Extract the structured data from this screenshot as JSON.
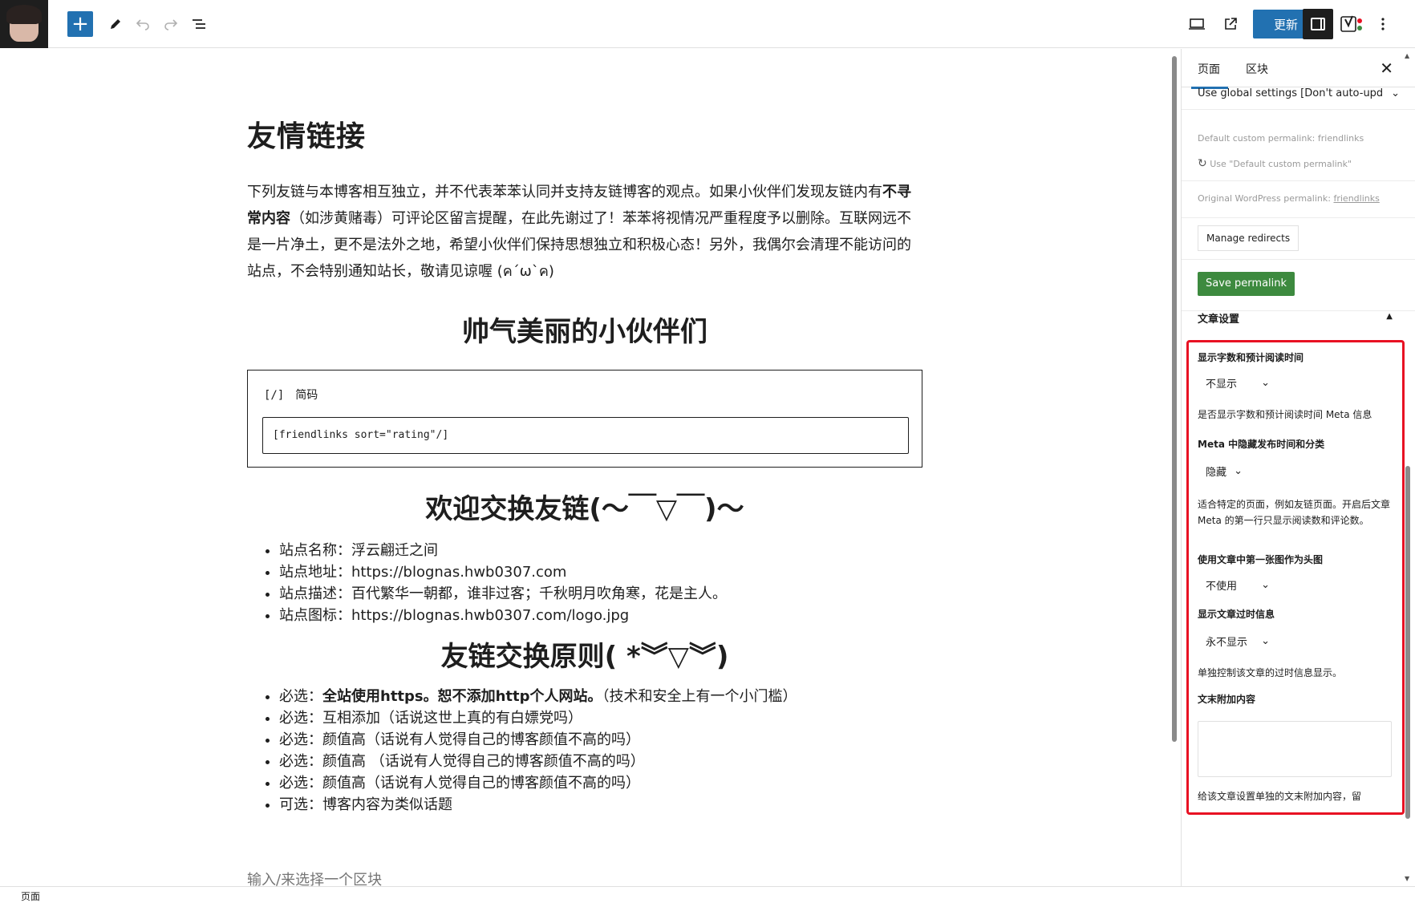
{
  "toolbar": {
    "update_label": "更新",
    "icons": [
      "add-icon",
      "pencil-icon",
      "undo-icon",
      "redo-icon",
      "list-view-icon",
      "desktop-preview-icon",
      "external-link-icon",
      "panel-icon",
      "yoast-icon",
      "more-icon"
    ]
  },
  "post": {
    "title": "友情链接",
    "intro_part1": "下列友链与本博客相互独立，并不代表苯苯认同并支持友链博客的观点。如果小伙伴们发现友链内有",
    "intro_bold": "不寻常内容",
    "intro_part2": "（如涉黄赌毒）可评论区留言提醒，在此先谢过了！苯苯将视情况严重程度予以删除。互联网远不是一片净土，更不是法外之地，希望小伙伴们保持思想独立和积极心态！另外，我偶尔会清理不能访问的站点，不会特别通知站长，敬请见谅喔 (ค´ω`ค)",
    "heading_friends": "帅气美丽的小伙伴们",
    "shortcode_bracket": "[/]",
    "shortcode_label": "简码",
    "shortcode_value": "[friendlinks sort=\"rating\"/]",
    "heading_exchange": "欢迎交换友链(～￣▽￣)～",
    "site_info": [
      "站点名称：浮云翩迁之间",
      "站点地址：https://blognas.hwb0307.com",
      "站点描述：百代繁华一朝都，谁非过客；千秋明月吹角寒，花是主人。",
      "站点图标：https://blognas.hwb0307.com/logo.jpg"
    ],
    "heading_rules": "友链交换原则( *︾▽︾)",
    "rule1_prefix": "必选：",
    "rule1_bold": "全站使用https。恕不添加http个人网站。",
    "rule1_suffix": "（技术和安全上有一个小门槛）",
    "rules": [
      "必选：互相添加（话说这世上真的有白嫖党吗）",
      "必选：颜值高（话说有人觉得自己的博客颜值不高的吗）",
      "必选：颜值高 （话说有人觉得自己的博客颜值不高的吗）",
      "必选：颜值高（话说有人觉得自己的博客颜值不高的吗）",
      "可选：博客内容为类似话题"
    ],
    "block_placeholder": "输入/来选择一个区块"
  },
  "sidebar": {
    "tab_page": "页面",
    "tab_block": "区块",
    "close": "✕",
    "global_select": "Use global settings [Don't auto-upd",
    "default_permalink_label": "Default custom permalink:",
    "default_permalink_value": "friendlinks",
    "use_default_link": "Use \"Default custom permalink\"",
    "original_permalink_label": "Original WordPress permalink:",
    "original_permalink_value": "friendlinks",
    "manage_redirects": "Manage redirects",
    "save_permalink": "Save permalink",
    "settings_title": "文章设置",
    "word_count_label": "显示字数和预计阅读时间",
    "word_count_value": "不显示",
    "word_count_help": "是否显示字数和预计阅读时间 Meta 信息",
    "meta_hide_label": "Meta 中隐藏发布时间和分类",
    "meta_hide_value": "隐藏",
    "meta_hide_help": "适合特定的页面，例如友链页面。开启后文章 Meta 的第一行只显示阅读数和评论数。",
    "first_image_label": "使用文章中第一张图作为头图",
    "first_image_value": "不使用",
    "outdated_label": "显示文章过时信息",
    "outdated_value": "永不显示",
    "outdated_help": "单独控制该文章的过时信息显示。",
    "append_label": "文末附加内容",
    "append_help": "给该文章设置单独的文末附加内容，留"
  },
  "statusbar": {
    "breadcrumb": "页面"
  },
  "colors": {
    "accent": "#2271b1",
    "save_green": "#3d8a3f",
    "highlight_red": "#e81123"
  }
}
